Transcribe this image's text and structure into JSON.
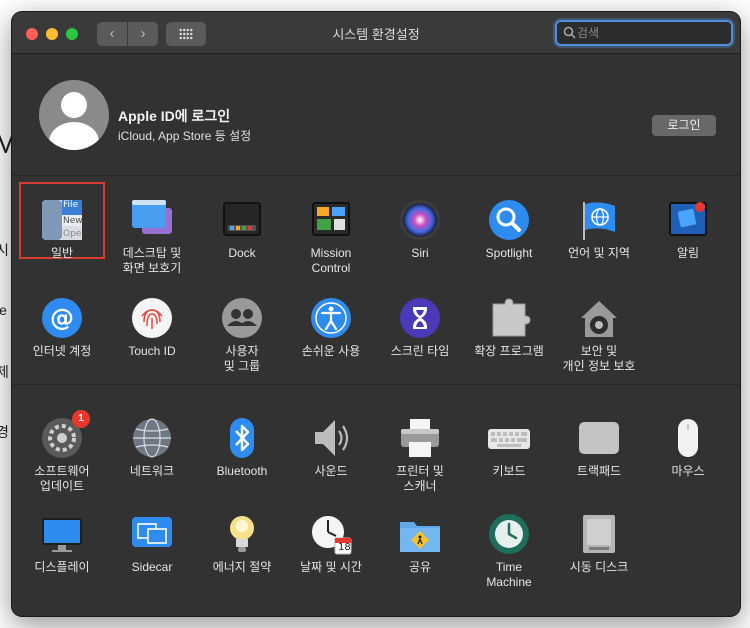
{
  "window": {
    "title": "시스템 환경설정"
  },
  "search": {
    "placeholder": "검색",
    "value": ""
  },
  "account": {
    "title": "Apple ID에 로그인",
    "subtitle": "iCloud, App Store 등 설정",
    "login_label": "로그인"
  },
  "background_chars": [
    "M",
    "시",
    "le",
    "제",
    "경"
  ],
  "colors": {
    "window_bg": "#323232",
    "selection_border": "#d83b32",
    "badge": "#e8372c",
    "search_focus": "#4d8ee0"
  },
  "rows": [
    {
      "items": [
        {
          "id": "general",
          "label": "일반",
          "icon": "general-icon",
          "selected": true
        },
        {
          "id": "desktop",
          "label": "데스크탑 및\n화면 보호기",
          "icon": "desktop-screensaver-icon"
        },
        {
          "id": "dock",
          "label": "Dock",
          "icon": "dock-icon"
        },
        {
          "id": "mission",
          "label": "Mission\nControl",
          "icon": "mission-control-icon"
        },
        {
          "id": "siri",
          "label": "Siri",
          "icon": "siri-icon"
        },
        {
          "id": "spotlight",
          "label": "Spotlight",
          "icon": "spotlight-icon"
        },
        {
          "id": "language",
          "label": "언어 및 지역",
          "icon": "language-region-icon"
        },
        {
          "id": "notifications",
          "label": "알림",
          "icon": "notifications-icon"
        }
      ]
    },
    {
      "items": [
        {
          "id": "internet",
          "label": "인터넷 계정",
          "icon": "internet-accounts-icon"
        },
        {
          "id": "touchid",
          "label": "Touch ID",
          "icon": "touch-id-icon"
        },
        {
          "id": "users",
          "label": "사용자\n및 그룹",
          "icon": "users-groups-icon"
        },
        {
          "id": "accessibility",
          "label": "손쉬운 사용",
          "icon": "accessibility-icon"
        },
        {
          "id": "screentime",
          "label": "스크린 타임",
          "icon": "screen-time-icon"
        },
        {
          "id": "extensions",
          "label": "확장 프로그램",
          "icon": "extensions-icon"
        },
        {
          "id": "security",
          "label": "보안 및\n개인 정보 보호",
          "icon": "security-privacy-icon"
        }
      ]
    },
    {
      "items": [
        {
          "id": "softwareupdate",
          "label": "소프트웨어\n업데이트",
          "icon": "software-update-icon",
          "badge": "1"
        },
        {
          "id": "network",
          "label": "네트워크",
          "icon": "network-icon"
        },
        {
          "id": "bluetooth",
          "label": "Bluetooth",
          "icon": "bluetooth-icon"
        },
        {
          "id": "sound",
          "label": "사운드",
          "icon": "sound-icon"
        },
        {
          "id": "printers",
          "label": "프린터 및\n스캐너",
          "icon": "printers-scanners-icon"
        },
        {
          "id": "keyboard",
          "label": "키보드",
          "icon": "keyboard-icon"
        },
        {
          "id": "trackpad",
          "label": "트랙패드",
          "icon": "trackpad-icon"
        },
        {
          "id": "mouse",
          "label": "마우스",
          "icon": "mouse-icon"
        }
      ]
    },
    {
      "items": [
        {
          "id": "displays",
          "label": "디스플레이",
          "icon": "displays-icon"
        },
        {
          "id": "sidecar",
          "label": "Sidecar",
          "icon": "sidecar-icon"
        },
        {
          "id": "energy",
          "label": "에너지 절약",
          "icon": "energy-saver-icon"
        },
        {
          "id": "datetime",
          "label": "날짜 및 시간",
          "icon": "date-time-icon",
          "calendar_day": "18"
        },
        {
          "id": "sharing",
          "label": "공유",
          "icon": "sharing-icon"
        },
        {
          "id": "timemachine",
          "label": "Time\nMachine",
          "icon": "time-machine-icon"
        },
        {
          "id": "startup",
          "label": "시동 디스크",
          "icon": "startup-disk-icon"
        }
      ]
    }
  ],
  "general_icon_text": [
    "File",
    "New",
    "Ope"
  ]
}
